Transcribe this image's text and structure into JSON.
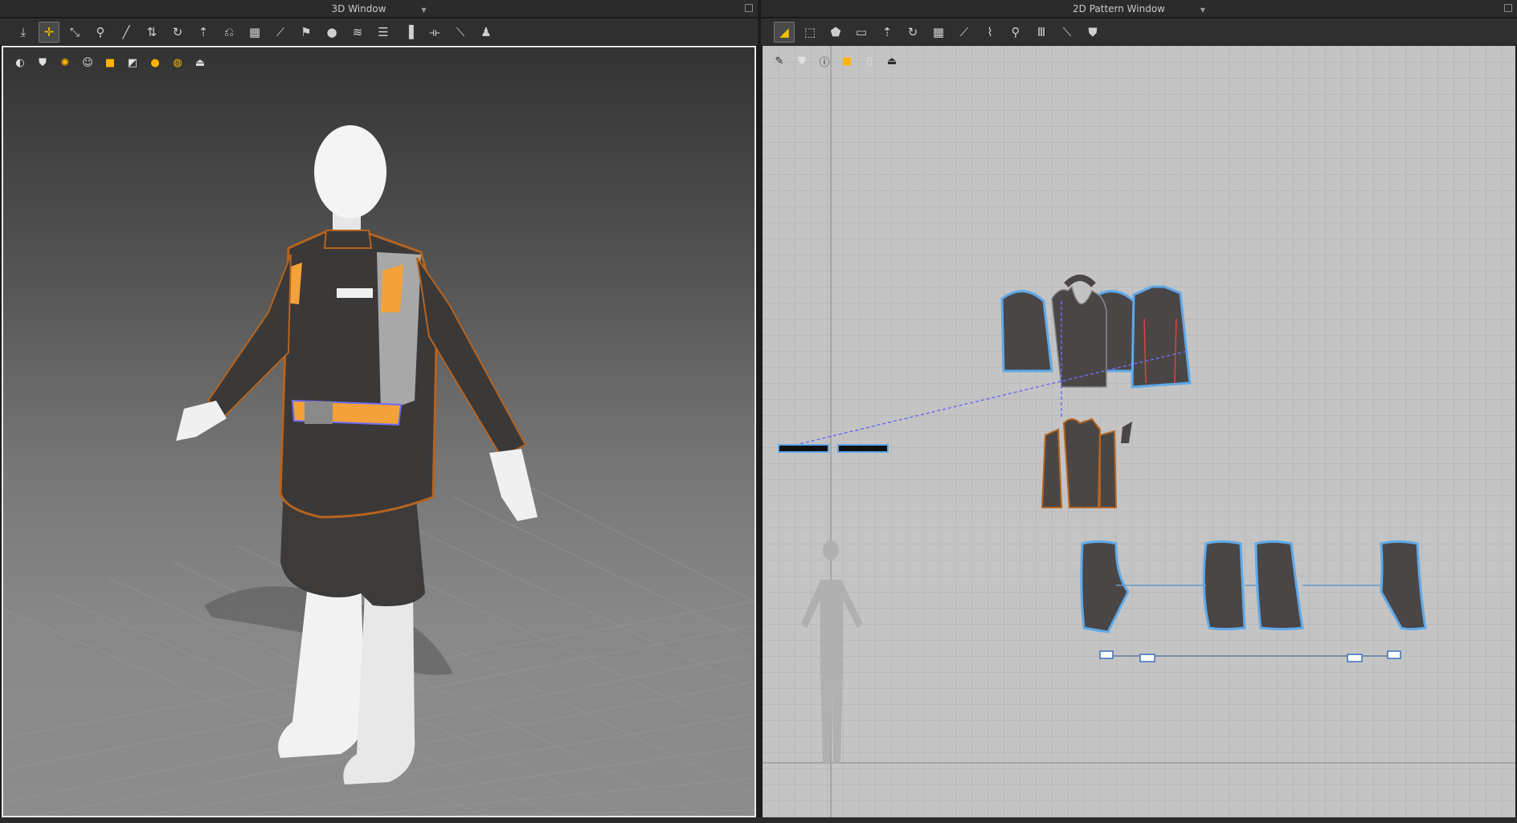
{
  "left_panel": {
    "title": "3D Window",
    "toolbar_icons": [
      "move-down-icon",
      "select-move-icon",
      "select-mesh-icon",
      "garment-pin-icon",
      "line-tool-icon",
      "fold-icon",
      "rotate-icon",
      "tack-icon",
      "tack-fold-icon",
      "grid-icon",
      "edge-icon",
      "pin-icon",
      "point-icon",
      "pile-icon",
      "stack-icon",
      "align-icon",
      "trim-icon",
      "measure-icon",
      "avatar-pose-icon"
    ],
    "viewport_icons": [
      "avatar-display-icon",
      "garment-display-icon",
      "texture-display-icon",
      "avatar-icon",
      "garment-shaded-icon",
      "pattern-outline-icon",
      "body-icon",
      "globe-icon",
      "export-icon"
    ]
  },
  "right_panel": {
    "title": "2D Pattern Window",
    "toolbar_icons": [
      "transform-pattern-icon",
      "edit-point-icon",
      "polygon-icon",
      "rectangle-icon",
      "internal-line-icon",
      "rotate-icon",
      "grid-icon",
      "sewing-icon",
      "seam-icon",
      "tack-icon",
      "multi-seam-icon",
      "measure-icon",
      "garment-icon"
    ],
    "viewport_icons": [
      "pen-icon",
      "pattern-display-icon",
      "info-icon",
      "fabric-icon",
      "texture-icon",
      "export-icon"
    ]
  },
  "colors": {
    "accent_orange": "#f3a23a",
    "pattern_fill": "#4a4646",
    "pattern_outline": "#5fa9e8",
    "seam_line": "#6f6cf2"
  }
}
